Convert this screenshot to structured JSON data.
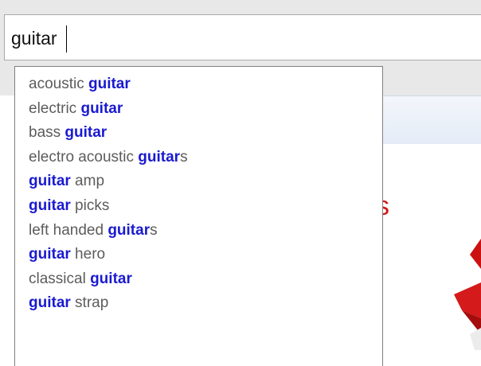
{
  "search": {
    "value": "guitar",
    "query": "guitar"
  },
  "suggestions": [
    {
      "pre": "acoustic ",
      "match": "guitar",
      "post": ""
    },
    {
      "pre": "electric ",
      "match": "guitar",
      "post": ""
    },
    {
      "pre": "bass ",
      "match": "guitar",
      "post": ""
    },
    {
      "pre": "electro acoustic ",
      "match": "guitar",
      "post": "s"
    },
    {
      "pre": "",
      "match": "guitar",
      "post": " amp"
    },
    {
      "pre": "",
      "match": "guitar",
      "post": " picks"
    },
    {
      "pre": "left handed ",
      "match": "guitar",
      "post": "s"
    },
    {
      "pre": "",
      "match": "guitar",
      "post": " hero"
    },
    {
      "pre": "classical ",
      "match": "guitar",
      "post": ""
    },
    {
      "pre": "",
      "match": "guitar",
      "post": " strap"
    }
  ],
  "colors": {
    "match": "#1a1ad0",
    "rest": "#5c5c5c",
    "partial_red": "#d21a1a"
  },
  "background": {
    "partial_text": "s"
  }
}
